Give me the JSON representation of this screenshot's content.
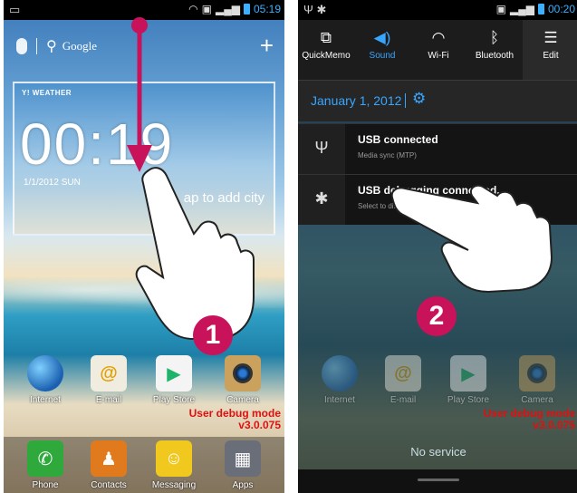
{
  "phone1": {
    "status_time": "05:19",
    "search_brand": "Google",
    "weather": {
      "brand": "WEATHER",
      "time": "00:19",
      "date": "1/1/2012 SUN",
      "add_city": "ap to add city"
    },
    "apps": [
      {
        "label": "Internet",
        "icon": "globe-icon"
      },
      {
        "label": "E-mail",
        "icon": "email-icon"
      },
      {
        "label": "Play Store",
        "icon": "play-store-icon"
      },
      {
        "label": "Camera",
        "icon": "camera-icon"
      }
    ],
    "debug_line1": "User debug mode",
    "debug_line2": "v3.0.075",
    "dock": [
      {
        "label": "Phone",
        "icon": "phone-icon"
      },
      {
        "label": "Contacts",
        "icon": "contacts-icon"
      },
      {
        "label": "Messaging",
        "icon": "messaging-icon"
      },
      {
        "label": "Apps",
        "icon": "apps-grid-icon"
      }
    ],
    "step_number": "1"
  },
  "phone2": {
    "status_time": "00:20",
    "quick_settings": [
      {
        "label": "QuickMemo",
        "icon": "quickmemo-icon",
        "active": false
      },
      {
        "label": "Sound",
        "icon": "sound-icon",
        "active": true
      },
      {
        "label": "Wi-Fi",
        "icon": "wifi-icon",
        "active": false
      },
      {
        "label": "Bluetooth",
        "icon": "bluetooth-icon",
        "active": false
      },
      {
        "label": "Edit",
        "icon": "edit-icon",
        "active": false
      }
    ],
    "date": "January 1, 2012",
    "notifications": [
      {
        "title": "USB connected",
        "subtitle": "Media sync (MTP)",
        "icon": "usb-icon"
      },
      {
        "title": "USB debugging connected.",
        "subtitle": "Select to disable USB debugging.",
        "icon": "android-icon"
      }
    ],
    "apps": [
      {
        "label": "Internet"
      },
      {
        "label": "E-mail"
      },
      {
        "label": "Play Store"
      },
      {
        "label": "Camera"
      }
    ],
    "debug_line1": "User debug mode",
    "debug_line2": "v3.0.075",
    "no_service": "No service",
    "step_number": "2"
  },
  "colors": {
    "accent_blue": "#38a6ff",
    "step_badge": "#c8125a",
    "debug_red": "#e01010"
  }
}
